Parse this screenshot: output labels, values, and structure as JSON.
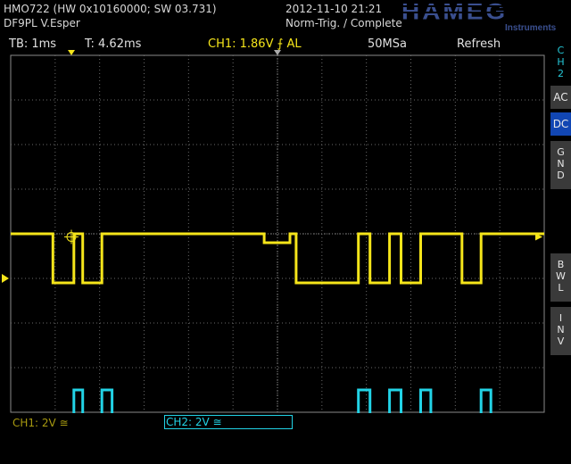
{
  "header": {
    "device": "HMO722 (HW 0x10160000; SW 03.731)",
    "owner": "DF9PL V.Esper",
    "datetime": "2012-11-10 21:21",
    "trigger_status": "Norm-Trig. / Complete",
    "brand": "HAMEG",
    "brand_sub": "Instruments"
  },
  "status": {
    "timebase": "TB: 1ms",
    "trigger_time": "T: 4.62ms",
    "ch1_trigger": "CH1: 1.86V ⨍ AL",
    "sample_rate": "50MSa",
    "mode": "Refresh"
  },
  "side_menu": {
    "channel_label": [
      "C",
      "H",
      "2"
    ],
    "ac": "AC",
    "dc": "DC",
    "gnd": [
      "G",
      "N",
      "D"
    ],
    "bwl": [
      "B",
      "W",
      "L"
    ],
    "inv": [
      "I",
      "N",
      "V"
    ]
  },
  "bottom": {
    "ch1_scale": "CH1: 2V ≅",
    "ch2_scale": "CH2: 2V ≅"
  },
  "colors": {
    "ch1": "#f5e51a",
    "ch2": "#22d3e6",
    "grid": "#6a6a6a",
    "active": "#1146b3"
  },
  "chart_data": {
    "type": "line",
    "x_unit": "ms",
    "y_unit": "V",
    "x_range": [
      0,
      12
    ],
    "divisions": {
      "x": 12,
      "y": 8
    },
    "series": [
      {
        "name": "CH1",
        "points": [
          [
            0,
            2.0
          ],
          [
            0.95,
            2.0
          ],
          [
            0.95,
            -0.2
          ],
          [
            1.42,
            -0.2
          ],
          [
            1.42,
            2.0
          ],
          [
            1.62,
            2.0
          ],
          [
            1.62,
            -0.2
          ],
          [
            2.05,
            -0.2
          ],
          [
            2.05,
            2.0
          ],
          [
            5.7,
            2.0
          ],
          [
            5.7,
            1.6
          ],
          [
            6.28,
            1.6
          ],
          [
            6.28,
            2.0
          ],
          [
            6.42,
            2.0
          ],
          [
            6.42,
            -0.2
          ],
          [
            7.82,
            -0.2
          ],
          [
            7.82,
            2.0
          ],
          [
            8.08,
            2.0
          ],
          [
            8.08,
            -0.2
          ],
          [
            8.52,
            -0.2
          ],
          [
            8.52,
            2.0
          ],
          [
            8.78,
            2.0
          ],
          [
            8.78,
            -0.2
          ],
          [
            9.22,
            -0.2
          ],
          [
            9.22,
            2.0
          ],
          [
            10.15,
            2.0
          ],
          [
            10.15,
            -0.2
          ],
          [
            10.58,
            -0.2
          ],
          [
            10.58,
            2.0
          ],
          [
            12,
            2.0
          ]
        ]
      },
      {
        "name": "CH2",
        "points": [
          [
            0,
            0
          ],
          [
            1.42,
            0
          ],
          [
            1.42,
            2.2
          ],
          [
            1.62,
            2.2
          ],
          [
            1.62,
            0
          ],
          [
            2.05,
            0
          ],
          [
            2.05,
            2.2
          ],
          [
            2.28,
            2.2
          ],
          [
            2.28,
            0
          ],
          [
            7.82,
            0
          ],
          [
            7.82,
            2.2
          ],
          [
            8.08,
            2.2
          ],
          [
            8.08,
            0
          ],
          [
            8.52,
            0
          ],
          [
            8.52,
            2.2
          ],
          [
            8.78,
            2.2
          ],
          [
            8.78,
            0
          ],
          [
            9.22,
            0
          ],
          [
            9.22,
            2.2
          ],
          [
            9.45,
            2.2
          ],
          [
            9.45,
            0
          ],
          [
            10.58,
            0
          ],
          [
            10.58,
            2.2
          ],
          [
            10.8,
            2.2
          ],
          [
            10.8,
            0
          ],
          [
            12,
            0
          ]
        ]
      }
    ]
  }
}
